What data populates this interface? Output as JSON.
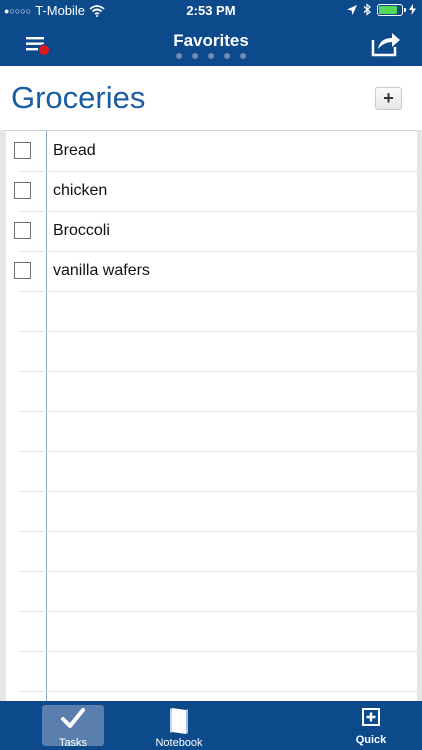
{
  "status": {
    "carrier": "T-Mobile",
    "time": "2:53 PM",
    "battery_level": 0.9,
    "battery_color": "#54d85a",
    "icons": [
      "signal-dots-icon",
      "wifi-icon",
      "location-arrow-icon",
      "bluetooth-icon",
      "battery-icon",
      "charging-bolt-icon"
    ]
  },
  "nav": {
    "title": "Favorites",
    "menu_icon": "list-menu-icon",
    "share_icon": "share-icon",
    "page_count": 5,
    "bar_color": "#0c4a8c"
  },
  "list": {
    "title": "Groceries",
    "add_label": "+",
    "title_color": "#1b5da3"
  },
  "tasks": [
    {
      "text": "Bread",
      "checked": false
    },
    {
      "text": "chicken",
      "checked": false
    },
    {
      "text": "Broccoli",
      "checked": false
    },
    {
      "text": "vanilla wafers",
      "checked": false
    }
  ],
  "tabs": {
    "tasks": {
      "label": "Tasks",
      "icon": "checkmark-icon",
      "selected": true
    },
    "notebook": {
      "label": "Notebook",
      "icon": "notebook-icon",
      "selected": false
    },
    "quick": {
      "label": "Quick",
      "icon": "plus-square-icon",
      "selected": false
    }
  }
}
